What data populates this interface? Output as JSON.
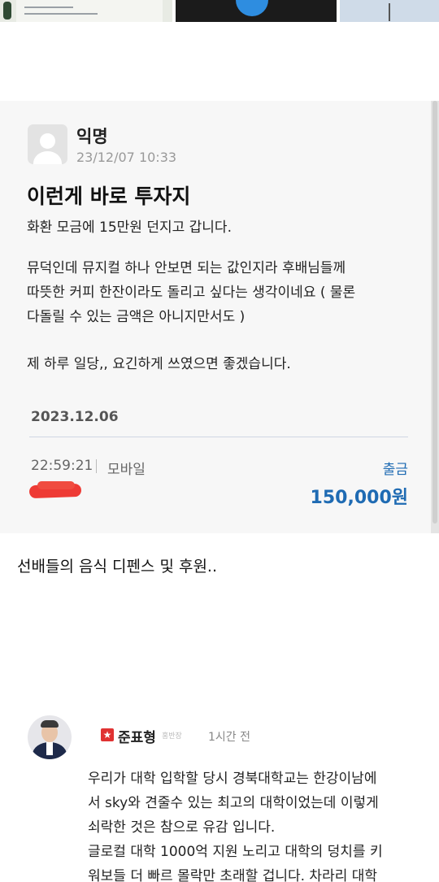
{
  "post": {
    "author": "익명",
    "date": "23/12/07 10:33",
    "title": "이런게 바로 투자지",
    "body": [
      "화환 모금에 15만원 던지고 갑니다.",
      "뮤덕인데 뮤지컬 하나 안보면 되는 값인지라 후배님들께",
      "따뜻한 커피 한잔이라도 돌리고 싶다는 생각이네요 ( 물론",
      "다돌릴 수 있는 금액은 아니지만서도 )",
      "제 하루 일당,, 요긴하게 쓰였으면 좋겠습니다."
    ]
  },
  "transaction": {
    "date": "2023.12.06",
    "time": "22:59:21",
    "channel": "모바일",
    "type": "출금",
    "amount": "150,000원"
  },
  "caption": "선배들의 음식 디펜스 및 후원..",
  "comment": {
    "author": "준표형",
    "role": "홍반장",
    "time": "1시간 전",
    "lines": [
      "우리가 대학 입학할 당시 경북대학교는 한강이남에",
      "서 sky와 견줄수 있는 최고의 대학이었는데 이렇게",
      "쇠락한 것은 참으로 유감 입니다.",
      "글로컬 대학 1000억 지원 노리고 대학의 덩치를 키",
      "워보들 더 빠르 몰락만 초래할 겁니다. 차라리 대학"
    ]
  },
  "colors": {
    "accent": "#1f6bb3",
    "redaction": "#ee3b35",
    "badge": "#e03232"
  }
}
